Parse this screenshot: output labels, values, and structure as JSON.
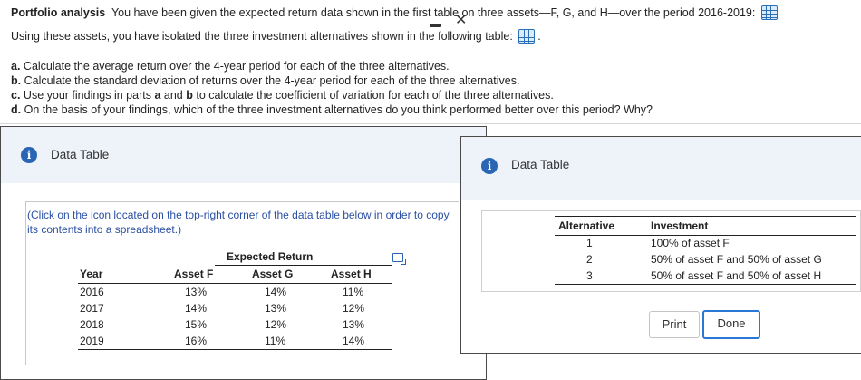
{
  "question": {
    "title": "Portfolio analysis",
    "line1": "You have been given the expected return data shown in the first table on three assets—F, G, and H—over the period 2016-2019:",
    "line2": "Using these assets, you have isolated the three investment alternatives shown in the following table:",
    "line2_end": ".",
    "parts": [
      {
        "letter": "a.",
        "text": "Calculate the average return over the 4-year period for each of the three alternatives."
      },
      {
        "letter": "b.",
        "text": "Calculate the standard deviation of returns over the 4-year period for each of the three alternatives."
      },
      {
        "letter": "c.",
        "text_before": "Use your findings in parts",
        "a": "a",
        "and": "and",
        "b": "b",
        "text_after": "to calculate the coefficient of variation for each of the three alternatives."
      },
      {
        "letter": "d.",
        "text": "On the basis of your findings, which of the three investment alternatives do you think performed better over this period?  Why?"
      }
    ]
  },
  "dialog1": {
    "title": "Data Table",
    "minimize_glyph": "–",
    "close_glyph": "✕",
    "note": "(Click on the icon located on the top-right corner of the data table below in order to copy its contents into a spreadsheet.)",
    "table": {
      "group_header": "Expected Return",
      "headers": [
        "Year",
        "Asset F",
        "Asset G",
        "Asset H"
      ],
      "rows": [
        [
          "2016",
          "13%",
          "14%",
          "11%"
        ],
        [
          "2017",
          "14%",
          "13%",
          "12%"
        ],
        [
          "2018",
          "15%",
          "12%",
          "13%"
        ],
        [
          "2019",
          "16%",
          "11%",
          "14%"
        ]
      ]
    }
  },
  "dialog2": {
    "title": "Data Table",
    "table": {
      "headers": [
        "Alternative",
        "Investment"
      ],
      "rows": [
        [
          "1",
          "100% of asset F"
        ],
        [
          "2",
          "50% of asset F and 50% of asset G"
        ],
        [
          "3",
          "50% of asset F and 50% of asset H"
        ]
      ]
    },
    "print_label": "Print",
    "done_label": "Done"
  }
}
